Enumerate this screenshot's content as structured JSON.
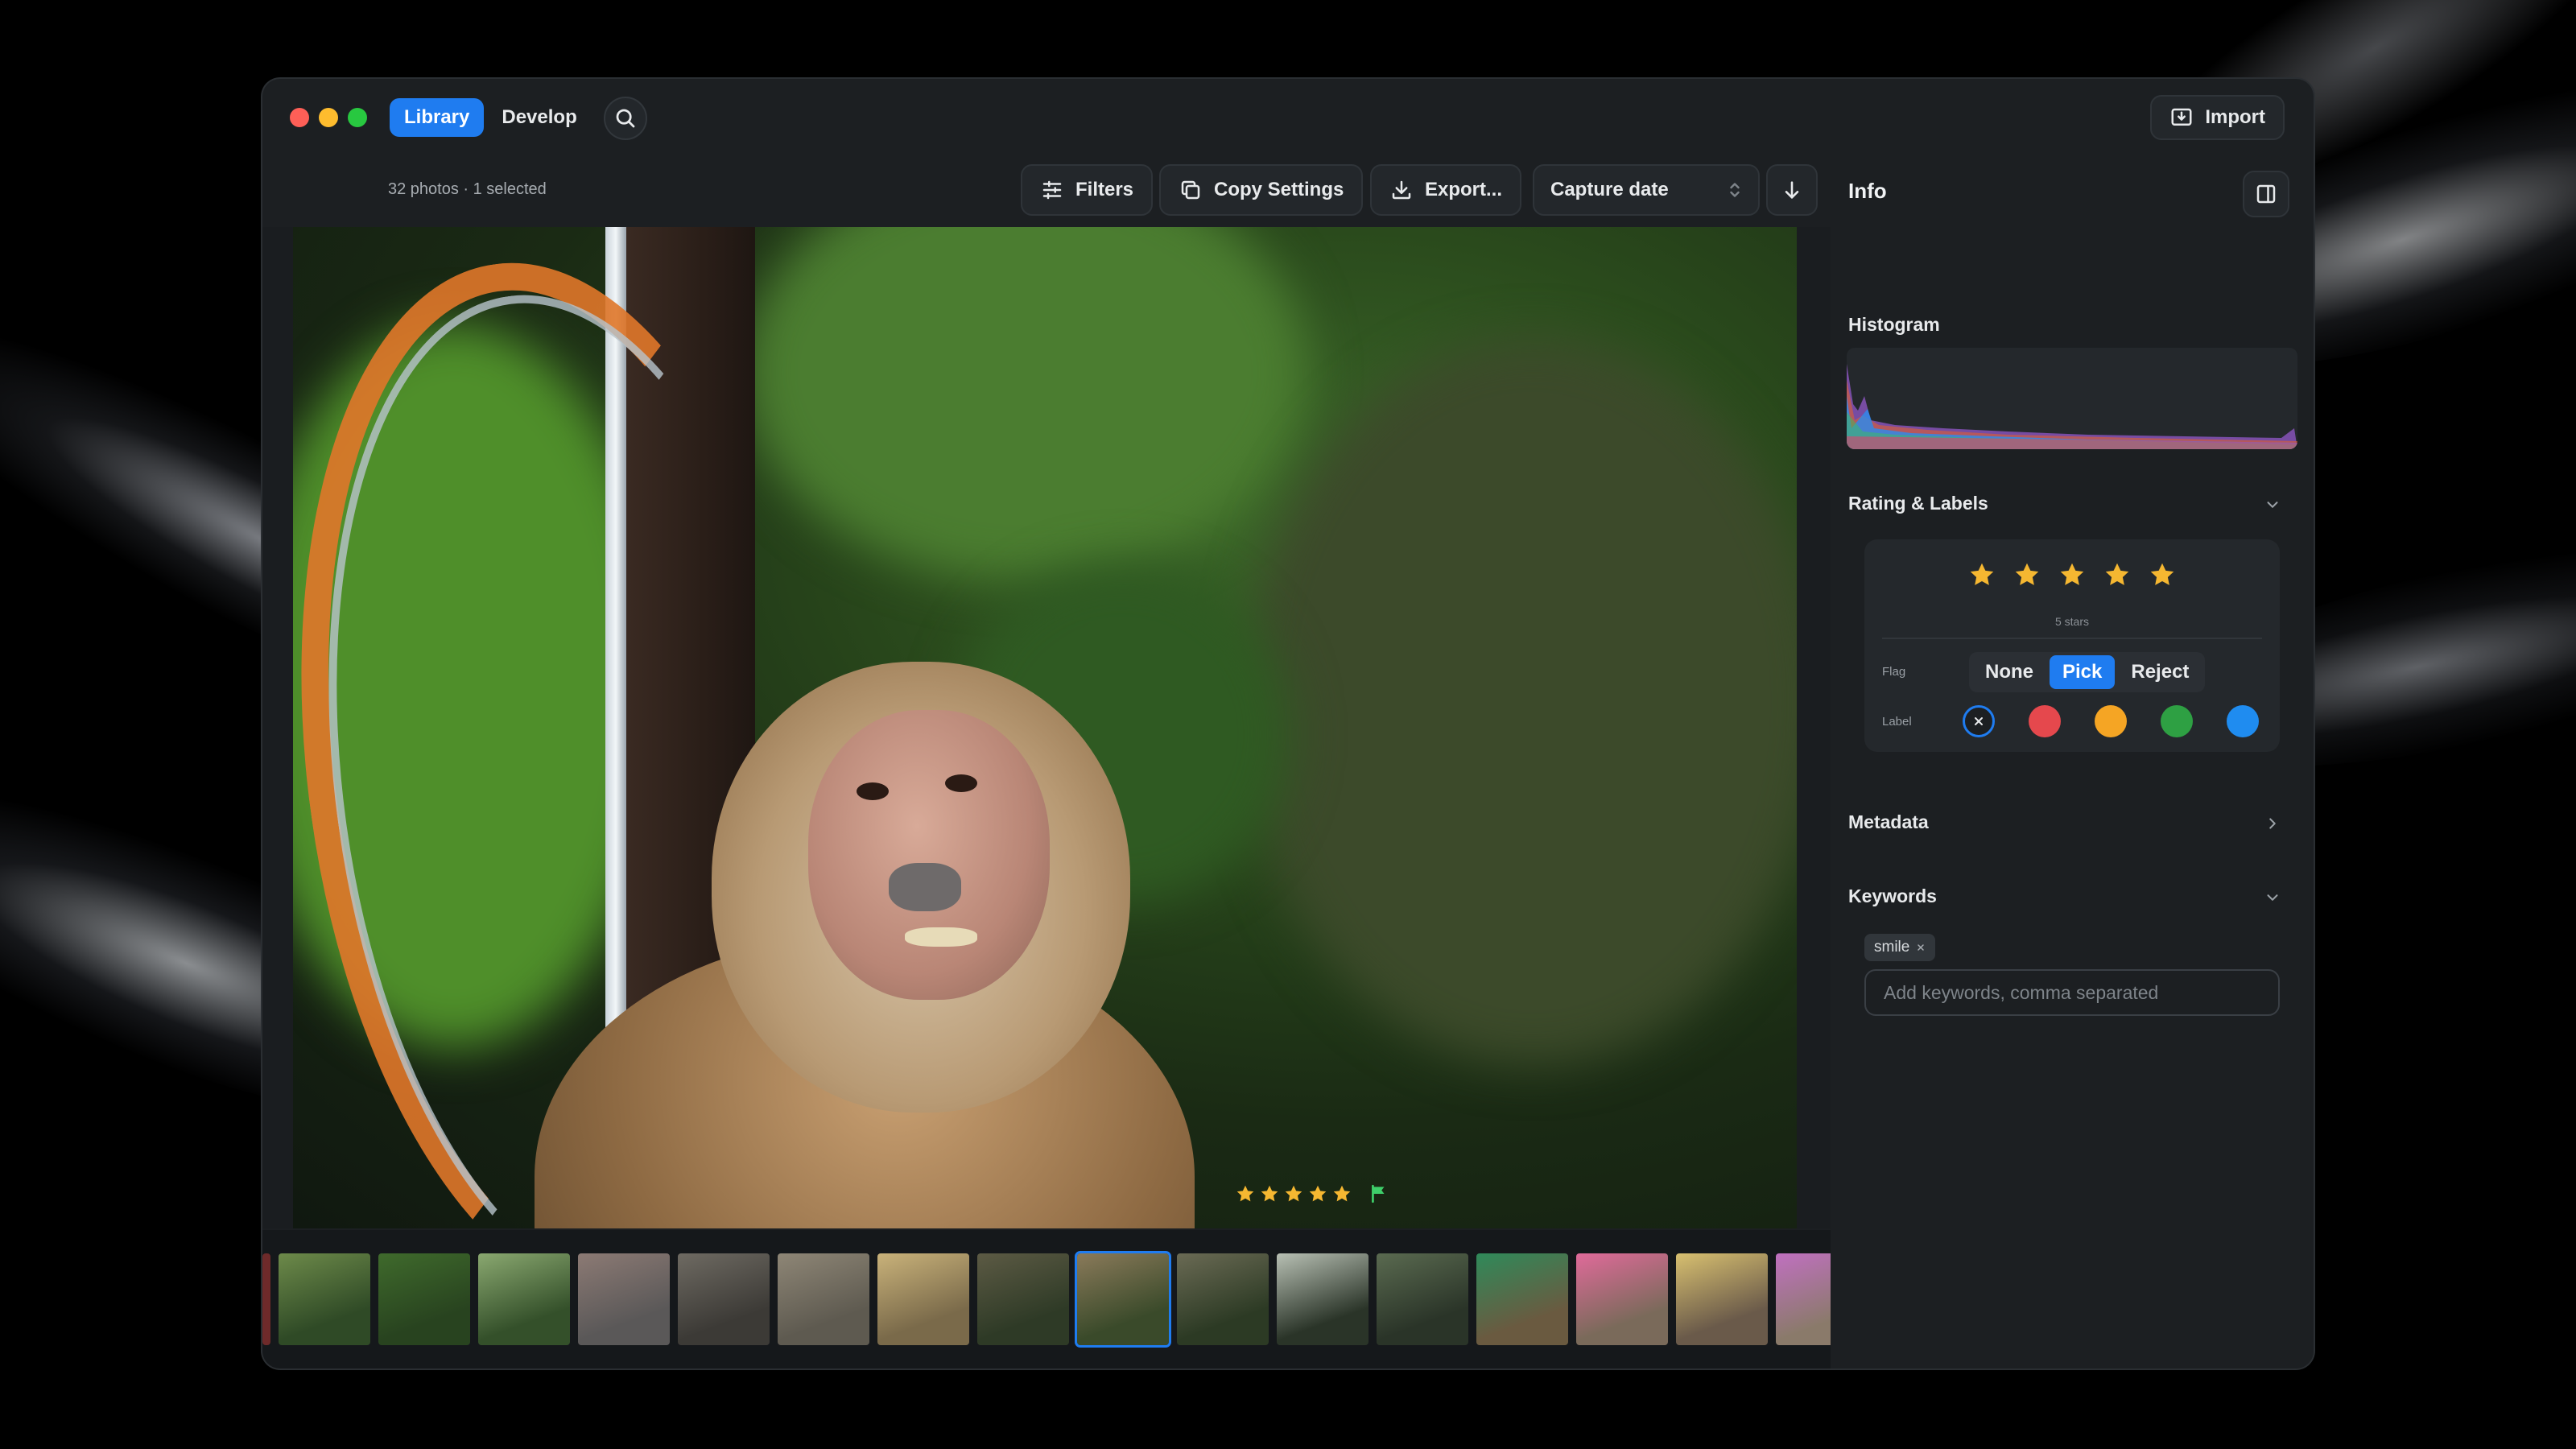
{
  "window": {
    "mode_tabs": [
      {
        "label": "Library",
        "active": true
      },
      {
        "label": "Develop",
        "active": false
      }
    ],
    "search_icon": "search-icon",
    "import_label": "Import"
  },
  "toolbar": {
    "photo_count": "32 photos · 1 selected",
    "filters_label": "Filters",
    "copy_settings_label": "Copy Settings",
    "export_label": "Export...",
    "sort_value": "Capture date",
    "sort_direction_icon": "arrow-down-icon"
  },
  "viewer": {
    "rating": 5,
    "flag": "pick",
    "flag_color": "#3ecf6a"
  },
  "filmstrip": {
    "count_visible": 16,
    "selected_index": 8
  },
  "info": {
    "title": "Info",
    "histogram_title": "Histogram",
    "rating_title": "Rating & Labels",
    "stars": 5,
    "stars_caption": "5 stars",
    "flag_label": "Flag",
    "flag_options": [
      "None",
      "Pick",
      "Reject"
    ],
    "flag_selected": "Pick",
    "label_label": "Label",
    "label_colors": [
      "none",
      "#e5484d",
      "#f5a524",
      "#2ea043",
      "#1f8cf0"
    ],
    "metadata_title": "Metadata",
    "keywords_title": "Keywords",
    "keywords": [
      "smile"
    ],
    "keywords_placeholder": "Add keywords, comma separated"
  },
  "colors": {
    "accent": "#1f7cf0",
    "star": "#f5b731",
    "panel_bg": "#1c1f22"
  }
}
